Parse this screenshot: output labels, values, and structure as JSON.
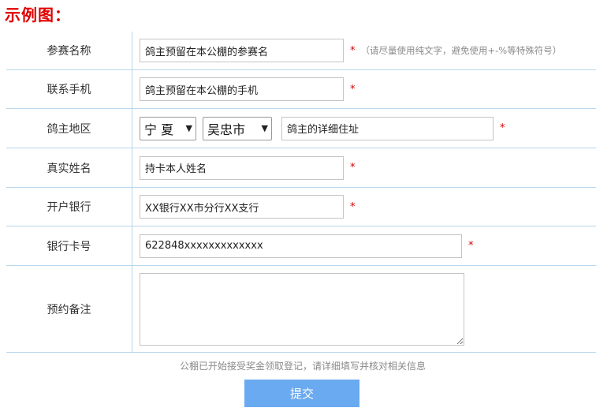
{
  "title": "示例图：",
  "form": {
    "rows": [
      {
        "label": "参赛名称",
        "value": "鸽主预留在本公棚的参赛名",
        "required": "*",
        "hint": "（请尽量使用纯文字，避免使用+-%等特殊符号）"
      },
      {
        "label": "联系手机",
        "value": "鸽主预留在本公棚的手机",
        "required": "*"
      },
      {
        "label": "鸽主地区",
        "province": "宁 夏",
        "city": "吴忠市",
        "value": "鸽主的详细住址",
        "required": "*"
      },
      {
        "label": "真实姓名",
        "value": "持卡本人姓名",
        "required": "*"
      },
      {
        "label": "开户银行",
        "value": "XX银行XX市分行XX支行",
        "required": "*"
      },
      {
        "label": "银行卡号",
        "value": "622848xxxxxxxxxxxxx",
        "required": "*"
      },
      {
        "label": "预约备注",
        "value": ""
      }
    ]
  },
  "notice": "公棚已开始接受奖金领取登记，请详细填写并核对相关信息",
  "submit_label": "提交"
}
